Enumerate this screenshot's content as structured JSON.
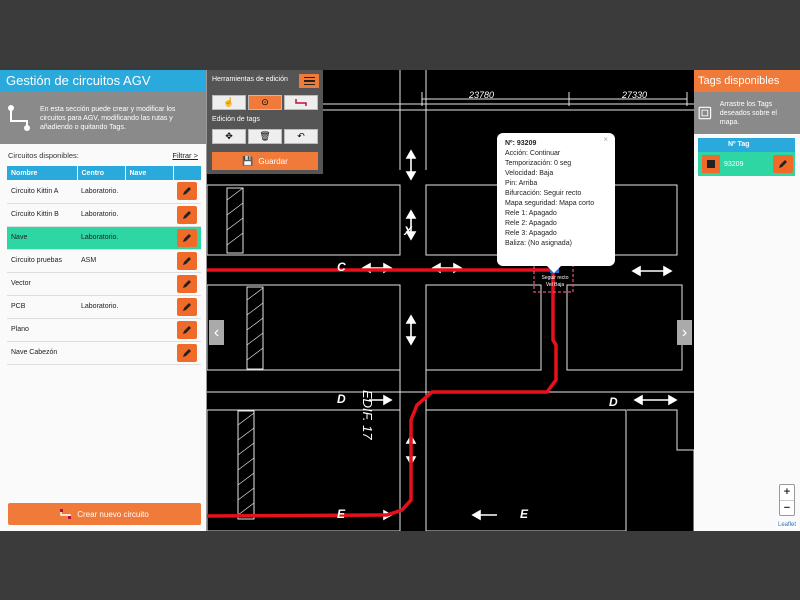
{
  "left_panel": {
    "title": "Gestión de circuitos AGV",
    "intro": "En esta sección puede crear y modificar los circuitos para AGV, modificando las rutas y añadiendo o quitando Tags.",
    "circuits_label": "Circuitos disponibles:",
    "filter_link": "Filtrar >",
    "columns": [
      "Nombre",
      "Centro",
      "Nave"
    ],
    "rows": [
      {
        "nombre": "Circuito Kittin A",
        "centro": "Laboratorio.",
        "nave": "",
        "selected": false
      },
      {
        "nombre": "Circuito Kittin B",
        "centro": "Laboratorio.",
        "nave": "",
        "selected": false
      },
      {
        "nombre": "Nave",
        "centro": "Laboratorio.",
        "nave": "",
        "selected": true
      },
      {
        "nombre": "Circuito pruebas",
        "centro": "ASM",
        "nave": "",
        "selected": false
      },
      {
        "nombre": "Vector",
        "centro": "",
        "nave": "",
        "selected": false
      },
      {
        "nombre": "PCB",
        "centro": "Laboratorio.",
        "nave": "",
        "selected": false
      },
      {
        "nombre": "Plano",
        "centro": "",
        "nave": "",
        "selected": false
      },
      {
        "nombre": "Nave Cabezón",
        "centro": "",
        "nave": "",
        "selected": false
      }
    ],
    "create_label": "Crear nuevo circuito"
  },
  "tools": {
    "title": "Herramientas de edición",
    "tags_edit_label": "Edición de tags",
    "save_label": "Guardar"
  },
  "popup": {
    "lines": [
      "Nº: 93209",
      "Acción: Continuar",
      "Temporización: 0 seg",
      "Velocidad: Baja",
      "Pin: Arriba",
      "Bifurcación: Seguir recto",
      "Mapa seguridad: Mapa corto",
      "Rele 1: Apagado",
      "Rele 2: Apagado",
      "Rele 3: Apagado",
      "Baliza: (No asignada)"
    ]
  },
  "marker": {
    "line1": "Seguir recto",
    "line2": "Vel Baja"
  },
  "map_labels": {
    "dim1": "23780",
    "dim2": "27330",
    "x_label": "X",
    "c_label": "C",
    "d_label": "D",
    "e_label": "E",
    "edif": "EDIF. 17"
  },
  "right_panel": {
    "title": "Tags disponibles",
    "intro": "Arrastre los Tags deseados sobre el mapa.",
    "column": "Nº Tag",
    "tags": [
      {
        "number": "93209"
      }
    ]
  },
  "zoom": {
    "plus": "+",
    "minus": "−"
  },
  "attribution": "Leaflet",
  "colors": {
    "accent_blue": "#2aaadc",
    "accent_orange": "#f07a3a",
    "selected_green": "#2ed6a3",
    "route_red": "#e8101a"
  }
}
